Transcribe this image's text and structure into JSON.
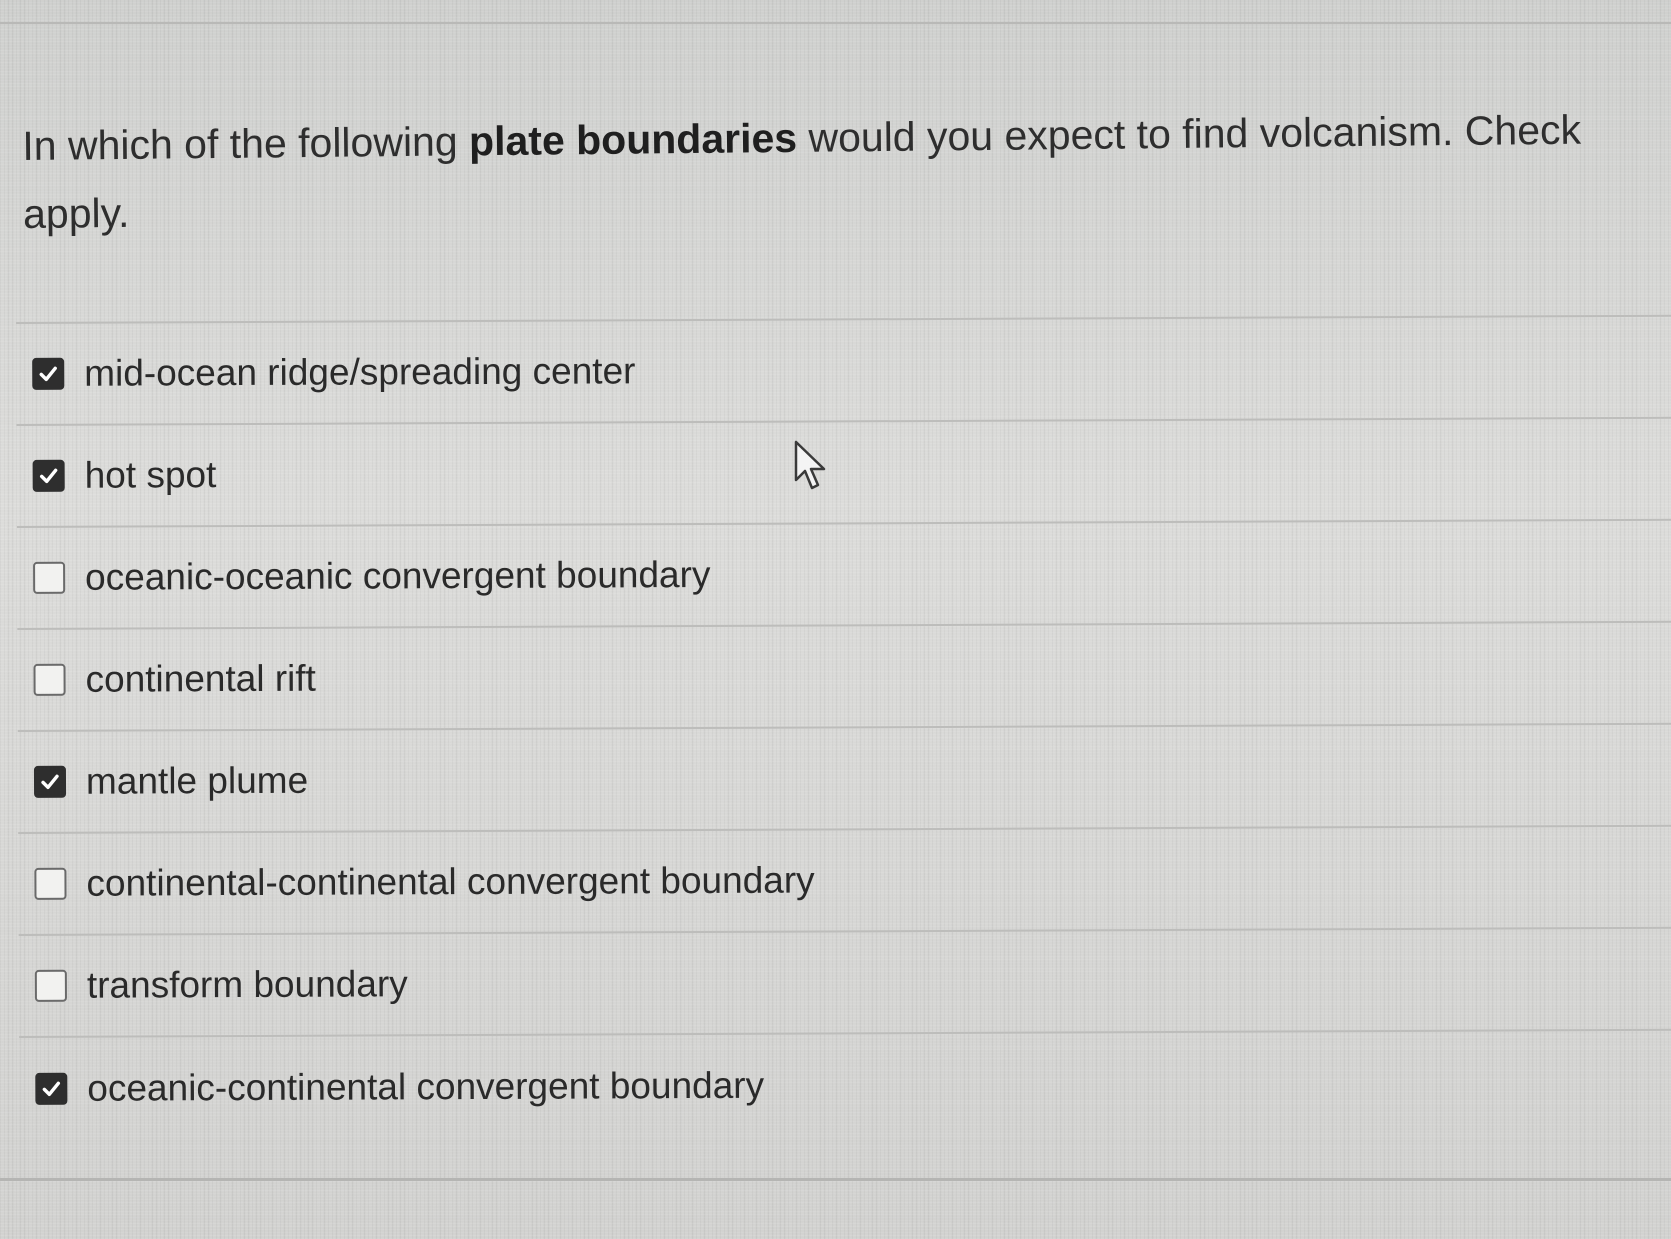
{
  "question": {
    "text_before": "In which of the following ",
    "text_bold": "plate boundaries",
    "text_after": " would you expect to find volcanism. Check apply."
  },
  "answers": [
    {
      "label": "mid-ocean ridge/spreading center",
      "checked": true
    },
    {
      "label": "hot spot",
      "checked": true
    },
    {
      "label": "oceanic-oceanic convergent boundary",
      "checked": false
    },
    {
      "label": "continental rift",
      "checked": false
    },
    {
      "label": "mantle plume",
      "checked": true
    },
    {
      "label": "continental-continental convergent boundary",
      "checked": false
    },
    {
      "label": "transform boundary",
      "checked": false
    },
    {
      "label": "oceanic-continental convergent boundary",
      "checked": true
    }
  ],
  "icons": {
    "checkmark": "checkmark-icon",
    "cursor": "mouse-pointer-icon"
  },
  "colors": {
    "background": "#d6d6d4",
    "text": "#2b2b2b",
    "checkbox_checked": "#2e2e2e",
    "divider": "#bdbdbb"
  }
}
